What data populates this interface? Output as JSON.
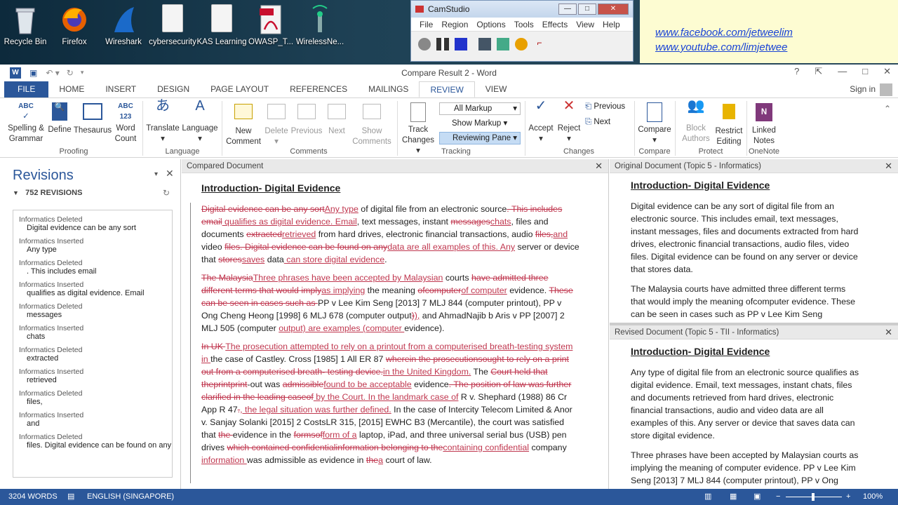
{
  "desktop": {
    "icons": [
      {
        "label": "Recycle Bin",
        "icon": "recycle-bin-icon"
      },
      {
        "label": "Firefox",
        "icon": "firefox-icon"
      },
      {
        "label": "Wireshark",
        "icon": "wireshark-icon"
      },
      {
        "label": "cybersecurity",
        "icon": "document-icon"
      },
      {
        "label": "KAS Learning",
        "icon": "document-icon"
      },
      {
        "label": "OWASP_T...",
        "icon": "pdf-icon"
      },
      {
        "label": "WirelessNe...",
        "icon": "wireless-icon"
      }
    ]
  },
  "camstudio": {
    "title": "CamStudio",
    "menu": [
      "File",
      "Region",
      "Options",
      "Tools",
      "Effects",
      "View",
      "Help"
    ]
  },
  "note": {
    "links": [
      "www.facebook.com/jetweelim",
      "www.youtube.com/limjetwee"
    ]
  },
  "word": {
    "title": "Compare Result 2 - Word",
    "signin": "Sign in",
    "tabs": [
      "FILE",
      "HOME",
      "INSERT",
      "DESIGN",
      "PAGE LAYOUT",
      "REFERENCES",
      "MAILINGS",
      "REVIEW",
      "VIEW"
    ],
    "ribbon": {
      "spelling": "Spelling &",
      "grammar": "Grammar",
      "define": "Define",
      "thesaurus": "Thesaurus",
      "word": "Word",
      "count": "Count",
      "translate": "Translate",
      "language": "Language",
      "new": "New",
      "comment": "Comment",
      "delete": "Delete",
      "previous": "Previous",
      "next": "Next",
      "show": "Show",
      "comments": "Comments",
      "track": "Track",
      "changes": "Changes",
      "all_markup": "All Markup",
      "show_markup": "Show Markup",
      "reviewing_pane": "Reviewing Pane",
      "accept": "Accept",
      "reject": "Reject",
      "prev_small": "Previous",
      "next_small": "Next",
      "compare": "Compare",
      "block": "Block",
      "authors": "Authors",
      "restrict": "Restrict",
      "editing": "Editing",
      "linked": "Linked",
      "notes": "Notes",
      "groups": {
        "proofing": "Proofing",
        "language": "Language",
        "comments": "Comments",
        "tracking": "Tracking",
        "changes": "Changes",
        "compare": "Compare",
        "protect": "Protect",
        "onenote": "OneNote"
      }
    },
    "revisions": {
      "title": "Revisions",
      "count": "752 REVISIONS",
      "items": [
        {
          "h": "Informatics Deleted",
          "t": "Digital evidence can be any sort"
        },
        {
          "h": "Informatics Inserted",
          "t": "Any type"
        },
        {
          "h": "Informatics Deleted",
          "t": ". This includes email"
        },
        {
          "h": "Informatics Inserted",
          "t": " qualifies as digital evidence. Email"
        },
        {
          "h": "Informatics Deleted",
          "t": "messages"
        },
        {
          "h": "Informatics Inserted",
          "t": "chats"
        },
        {
          "h": "Informatics Deleted",
          "t": "extracted"
        },
        {
          "h": "Informatics Inserted",
          "t": "retrieved"
        },
        {
          "h": "Informatics Deleted",
          "t": "files,"
        },
        {
          "h": "Informatics Inserted",
          "t": "and"
        },
        {
          "h": "Informatics Deleted",
          "t": "files. Digital evidence can be found on any"
        }
      ]
    },
    "compared": {
      "header": "Compared Document",
      "heading": "Introduction- Digital Evidence"
    },
    "original": {
      "header": "Original Document (Topic 5 - Informatics)",
      "heading": "Introduction- Digital Evidence",
      "p1": "Digital evidence can be any sort of digital file from an electronic source. This includes email, text messages, instant messages, files and documents extracted from hard drives, electronic financial transactions, audio files, video files. Digital evidence can be found on any server or device that stores data.",
      "p2": "The Malaysia courts have admitted three different terms that would imply the meaning ofcomputer evidence. These can be seen in cases such as PP v Lee Kim Seng"
    },
    "revised": {
      "header": "Revised Document (Topic 5 - TII - Informatics)",
      "heading": "Introduction- Digital Evidence",
      "p1": "Any type of digital file from an electronic source qualifies as digital evidence. Email, text messages, instant chats, files and documents retrieved from hard drives, electronic financial transactions, audio and video data are all examples of this. Any server or device that saves data can store digital evidence.",
      "p2": "Three phrases have been accepted by Malaysian courts as implying the meaning of computer evidence. PP v Lee Kim Seng [2013] 7 MLJ 844 (computer printout), PP v Ong"
    },
    "status": {
      "words": "3204 WORDS",
      "lang": "ENGLISH (SINGAPORE)",
      "zoom": "100%"
    }
  }
}
